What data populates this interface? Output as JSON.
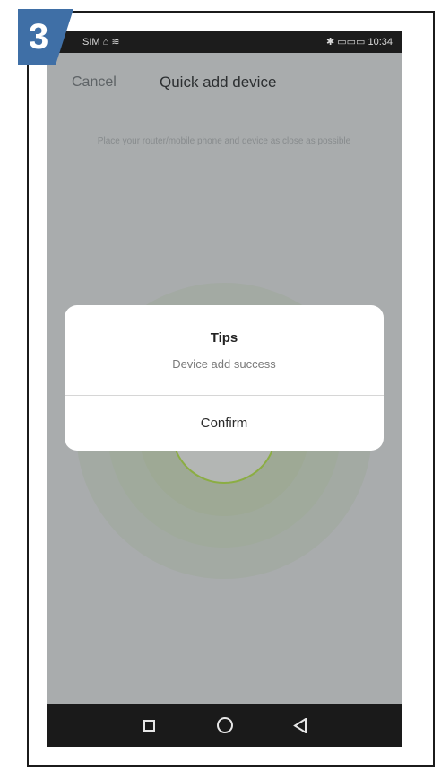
{
  "step": {
    "number": "3"
  },
  "status_bar": {
    "left": "SIM ⌂ ≋",
    "right": "✱ ▭▭▭ 10:34"
  },
  "header": {
    "cancel_label": "Cancel",
    "title": "Quick add device"
  },
  "hint": {
    "text": "Place your router/mobile phone  and device as close as possible"
  },
  "dialog": {
    "title": "Tips",
    "message": "Device add success",
    "confirm_label": "Confirm"
  },
  "bottom_nav": {
    "icons": [
      "recents-square-icon",
      "home-circle-icon",
      "back-triangle-icon"
    ]
  },
  "colors": {
    "step_badge": "#3f6fa6",
    "radar_accent": "#8bad43",
    "overlay_gray": "#a9acad",
    "dialog_bg": "#ffffff"
  }
}
